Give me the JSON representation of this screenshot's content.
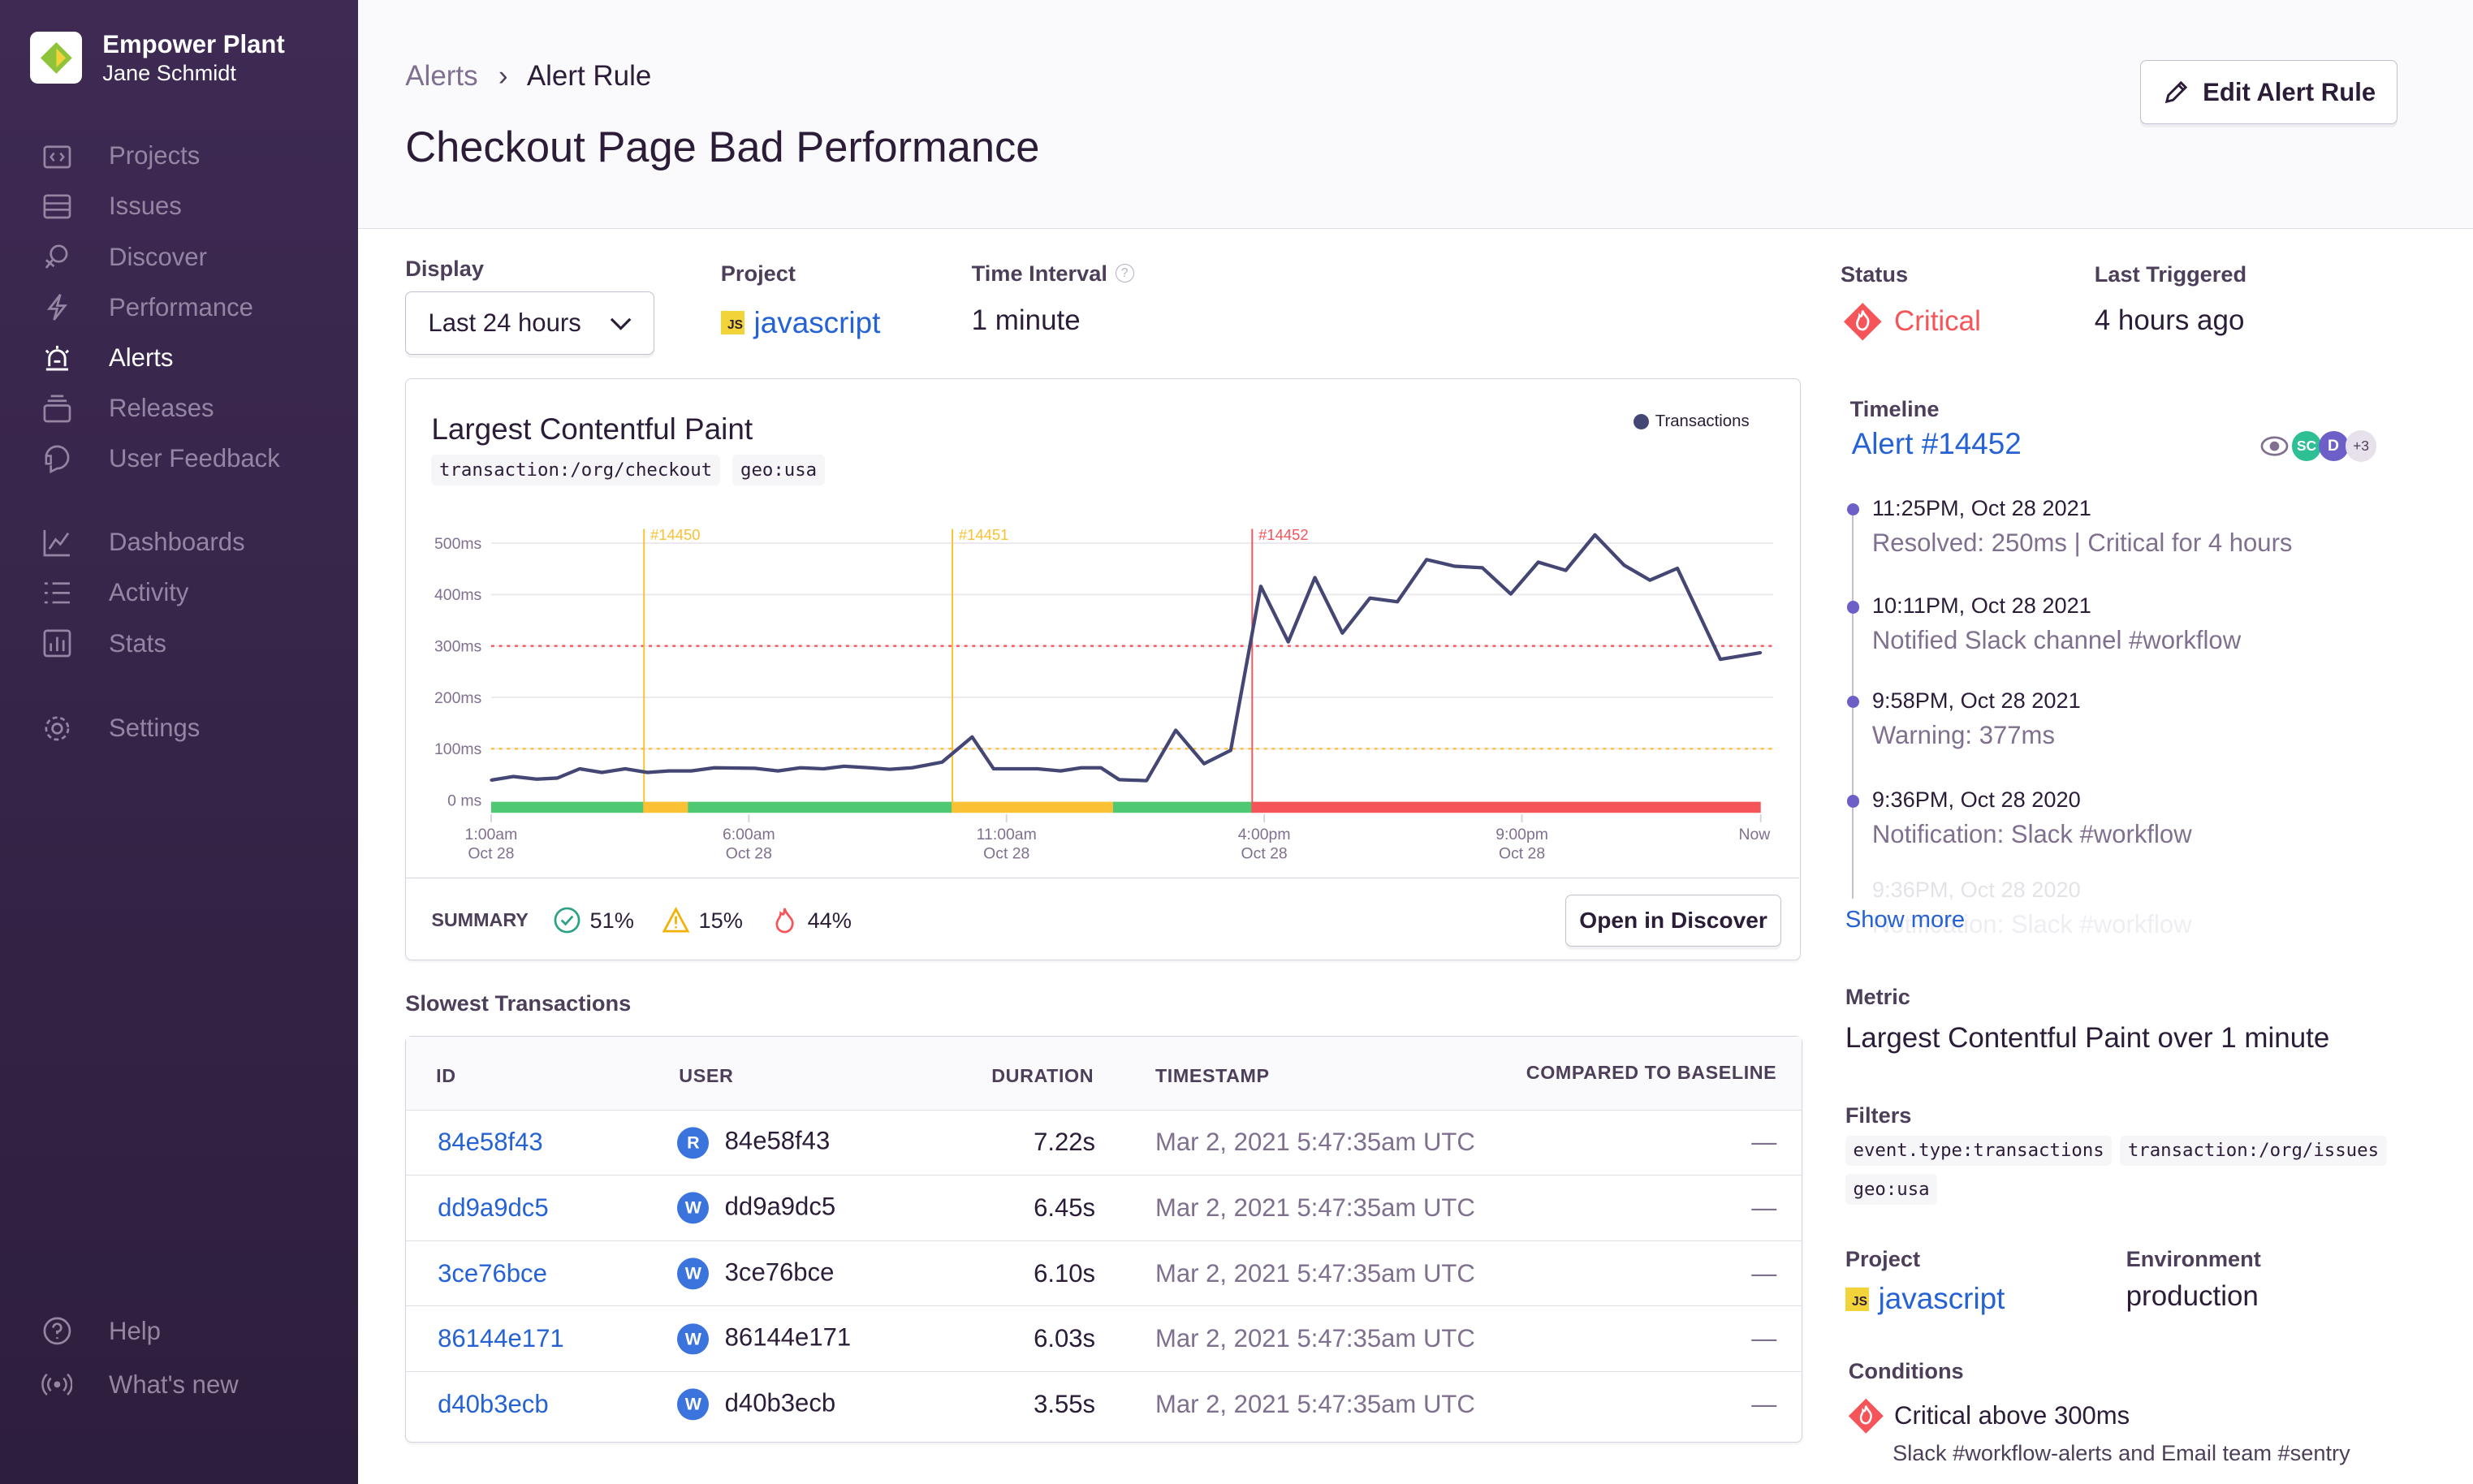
{
  "sidebar": {
    "org_name": "Empower Plant",
    "user_name": "Jane Schmidt",
    "items": [
      {
        "label": "Projects",
        "icon": "projects-icon"
      },
      {
        "label": "Issues",
        "icon": "issues-icon"
      },
      {
        "label": "Discover",
        "icon": "discover-icon"
      },
      {
        "label": "Performance",
        "icon": "performance-icon"
      },
      {
        "label": "Alerts",
        "icon": "alerts-icon",
        "active": true
      },
      {
        "label": "Releases",
        "icon": "releases-icon"
      },
      {
        "label": "User Feedback",
        "icon": "user-feedback-icon"
      },
      {
        "label": "Dashboards",
        "icon": "dashboards-icon"
      },
      {
        "label": "Activity",
        "icon": "activity-icon"
      },
      {
        "label": "Stats",
        "icon": "stats-icon"
      },
      {
        "label": "Settings",
        "icon": "settings-icon"
      }
    ],
    "footer": [
      {
        "label": "Help",
        "icon": "help-icon"
      },
      {
        "label": "What's new",
        "icon": "broadcast-icon"
      }
    ]
  },
  "header": {
    "breadcrumb": [
      "Alerts",
      "Alert Rule"
    ],
    "title": "Checkout Page Bad Performance",
    "edit_button": "Edit Alert Rule"
  },
  "controls": {
    "display_label": "Display",
    "display_value": "Last 24 hours",
    "project_label": "Project",
    "project_value": "javascript",
    "project_badge": "JS",
    "interval_label": "Time Interval",
    "interval_value": "1 minute"
  },
  "chart_data": {
    "type": "line",
    "title": "Largest Contentful Paint",
    "filters": [
      "transaction:/org/checkout",
      "geo:usa"
    ],
    "legend": {
      "label": "Transactions",
      "position": "top-right",
      "color": "#444674"
    },
    "ylim": [
      0,
      500
    ],
    "y_ticks": [
      "0 ms",
      "100ms",
      "200ms",
      "300ms",
      "400ms",
      "500ms"
    ],
    "x_ticks": [
      {
        "t": "01:00",
        "label": [
          "1:00am",
          "Oct 28"
        ]
      },
      {
        "t": "06:00",
        "label": [
          "6:00am",
          "Oct 28"
        ]
      },
      {
        "t": "11:00",
        "label": [
          "11:00am",
          "Oct 28"
        ]
      },
      {
        "t": "16:00",
        "label": [
          "4:00pm",
          "Oct 28"
        ]
      },
      {
        "t": "21:00",
        "label": [
          "9:00pm",
          "Oct 28"
        ]
      },
      {
        "t": "25:38",
        "label": [
          "Now",
          ""
        ]
      }
    ],
    "series": [
      {
        "name": "Transactions",
        "x": [
          "01:00",
          "01:26",
          "01:53",
          "02:17",
          "02:43",
          "03:09",
          "03:36",
          "04:02",
          "04:27",
          "04:53",
          "05:20",
          "06:07",
          "06:34",
          "07:00",
          "07:27",
          "07:51",
          "08:20",
          "08:44",
          "09:10",
          "09:45",
          "10:20",
          "10:45",
          "11:36",
          "12:03",
          "12:27",
          "12:50",
          "13:11",
          "13:43",
          "14:17",
          "14:50",
          "15:21",
          "15:56",
          "16:28",
          "16:59",
          "17:31",
          "18:03",
          "18:35",
          "19:09",
          "19:42",
          "20:14",
          "20:47",
          "21:19",
          "21:51",
          "22:25",
          "22:59",
          "23:29",
          "24:01",
          "24:51",
          "25:38"
        ],
        "values": [
          39,
          46,
          41,
          43,
          61,
          54,
          61,
          54,
          57,
          57,
          63,
          62,
          57,
          63,
          61,
          66,
          63,
          60,
          63,
          74,
          123,
          61,
          61,
          57,
          63,
          63,
          40,
          38,
          136,
          71,
          97,
          416,
          308,
          433,
          325,
          393,
          386,
          468,
          455,
          452,
          401,
          463,
          447,
          516,
          457,
          428,
          451,
          274,
          287
        ]
      }
    ],
    "thresholds": [
      {
        "label": "critical",
        "value": 300,
        "color": "#f55459"
      },
      {
        "label": "warning",
        "value": 100,
        "color": "#f9c133"
      }
    ],
    "incidents": [
      {
        "label": "#14450",
        "t": "03:58",
        "color": "#f9c133"
      },
      {
        "label": "#14451",
        "t": "09:57",
        "color": "#f9c133"
      },
      {
        "label": "#14452",
        "t": "15:46",
        "color": "#f55459"
      }
    ],
    "status_segments": [
      {
        "from": "01:00",
        "to": "03:58",
        "status": "ok"
      },
      {
        "from": "03:58",
        "to": "04:49",
        "status": "warning"
      },
      {
        "from": "04:49",
        "to": "09:57",
        "status": "ok"
      },
      {
        "from": "09:57",
        "to": "13:04",
        "status": "warning"
      },
      {
        "from": "13:04",
        "to": "15:46",
        "status": "ok"
      },
      {
        "from": "15:46",
        "to": "25:38",
        "status": "critical"
      }
    ],
    "colors": {
      "ok": "#4fc873",
      "warning": "#f9c133",
      "critical": "#f55459",
      "line": "#444674"
    }
  },
  "summary": {
    "label": "SUMMARY",
    "ok": "51%",
    "warning": "15%",
    "critical": "44%",
    "open_button": "Open in Discover"
  },
  "transactions": {
    "title": "Slowest Transactions",
    "columns": [
      "ID",
      "USER",
      "DURATION",
      "TIMESTAMP",
      "COMPARED TO BASELINE"
    ],
    "rows": [
      {
        "id": "84e58f43",
        "avatar": "R",
        "user": "84e58f43",
        "duration": "7.22s",
        "timestamp": "Mar 2, 2021 5:47:35am UTC",
        "baseline": "—"
      },
      {
        "id": "dd9a9dc5",
        "avatar": "W",
        "user": "dd9a9dc5",
        "duration": "6.45s",
        "timestamp": "Mar 2, 2021 5:47:35am UTC",
        "baseline": "—"
      },
      {
        "id": "3ce76bce",
        "avatar": "W",
        "user": "3ce76bce",
        "duration": "6.10s",
        "timestamp": "Mar 2, 2021 5:47:35am UTC",
        "baseline": "—"
      },
      {
        "id": "86144e171",
        "avatar": "W",
        "user": "86144e171",
        "duration": "6.03s",
        "timestamp": "Mar 2, 2021 5:47:35am UTC",
        "baseline": "—"
      },
      {
        "id": "d40b3ecb",
        "avatar": "W",
        "user": "d40b3ecb",
        "duration": "3.55s",
        "timestamp": "Mar 2, 2021 5:47:35am UTC",
        "baseline": "—"
      }
    ]
  },
  "status": {
    "label": "Status",
    "value": "Critical",
    "last_label": "Last Triggered",
    "last_value": "4 hours ago"
  },
  "timeline": {
    "label": "Timeline",
    "alert": "Alert #14452",
    "avatars": [
      "SC",
      "D",
      "+3"
    ],
    "events": [
      {
        "time": "11:25PM, Oct 28 2021",
        "desc": "Resolved: 250ms | Critical for 4 hours"
      },
      {
        "time": "10:11PM, Oct 28 2021",
        "desc": "Notified Slack channel #workflow"
      },
      {
        "time": "9:58PM, Oct 28 2021",
        "desc": "Warning: 377ms"
      },
      {
        "time": "9:36PM, Oct 28 2020",
        "desc": "Notification: Slack #workflow"
      },
      {
        "time": "9:36PM, Oct 28 2020",
        "desc": "Notification: Slack #workflow"
      }
    ],
    "show_more": "Show more"
  },
  "details": {
    "metric_label": "Metric",
    "metric_value": "Largest Contentful Paint over 1 minute",
    "filters_label": "Filters",
    "filters": [
      "event.type:transactions",
      "transaction:/org/issues",
      "geo:usa"
    ],
    "project_label": "Project",
    "project_value": "javascript",
    "env_label": "Environment",
    "env_value": "production",
    "conditions_label": "Conditions",
    "condition": "Critical above 300ms",
    "condition_actions": "Slack #workflow-alerts and Email team #sentry"
  }
}
